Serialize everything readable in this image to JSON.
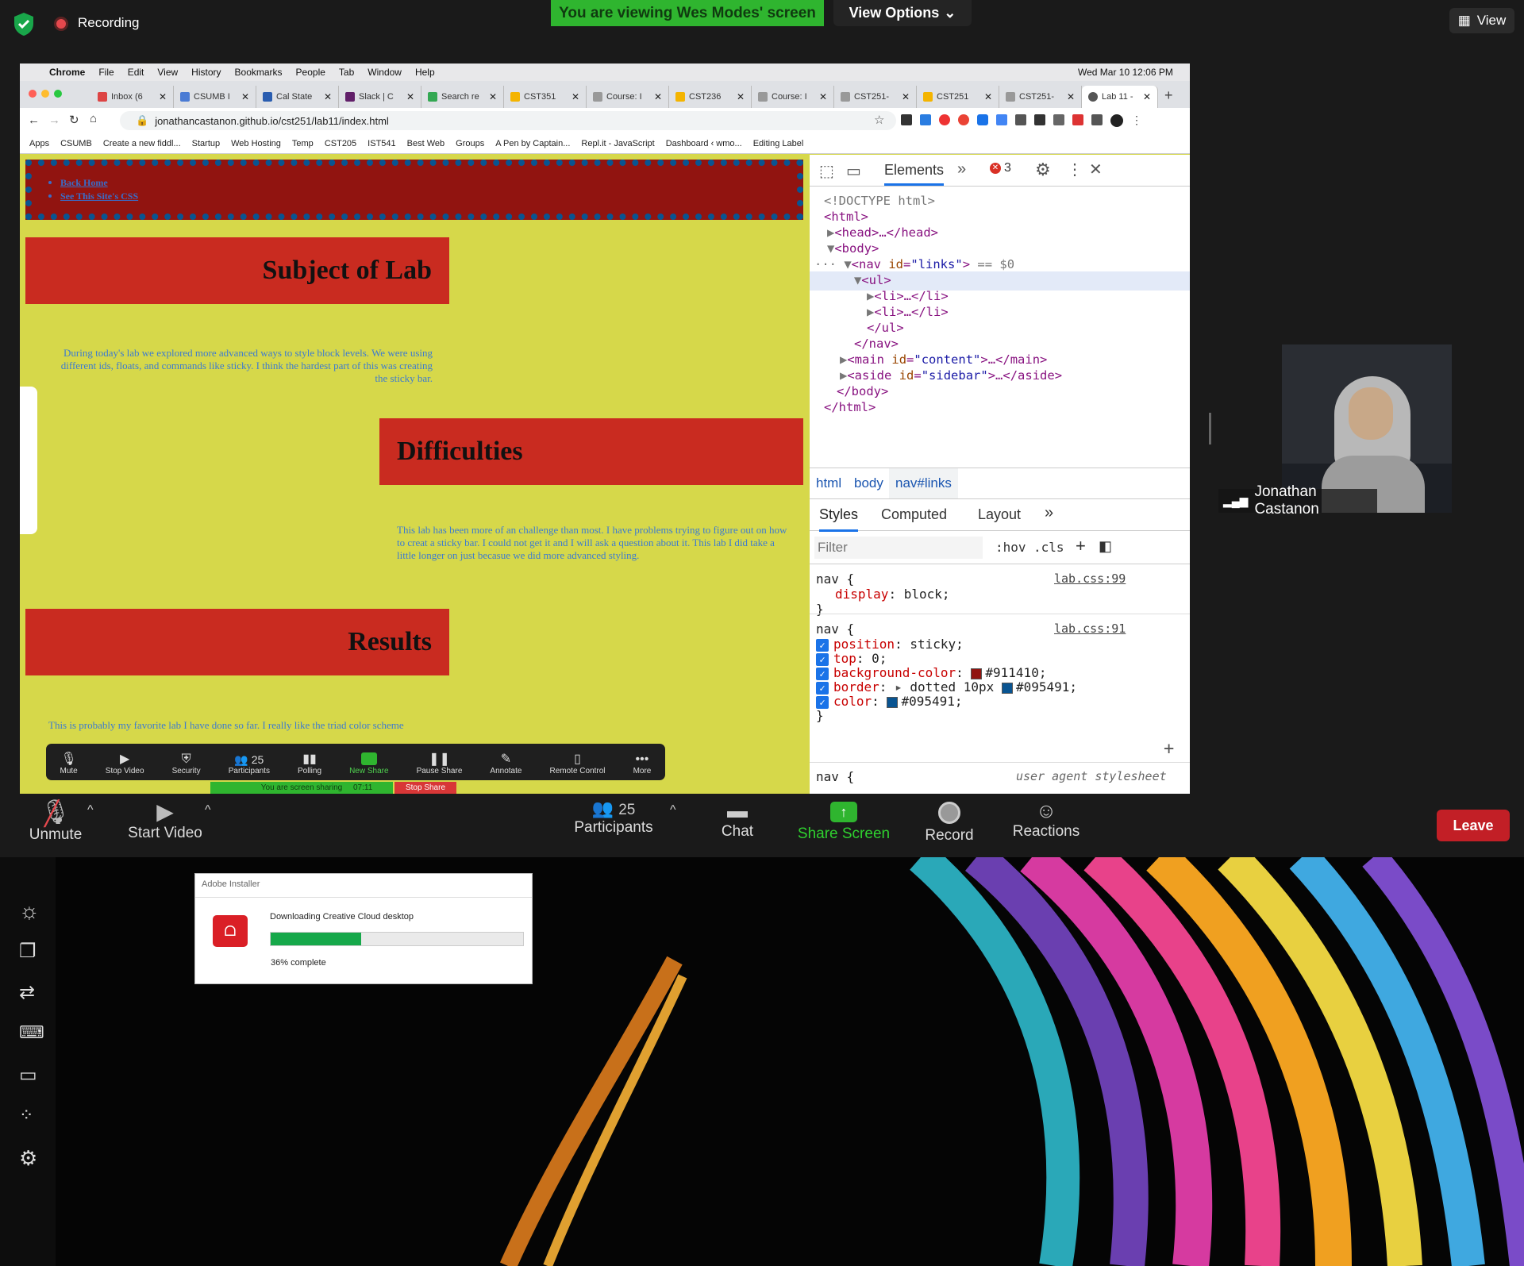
{
  "zoom": {
    "recording_label": "Recording",
    "viewing_banner": "You are viewing Wes Modes' screen",
    "view_options_label": "View Options",
    "view_label": "View",
    "participant_name": "Jonathan Castanon",
    "participants_count": "25",
    "bottom_controls": [
      {
        "label": "Unmute",
        "icon": "mic-muted-icon"
      },
      {
        "label": "Start Video",
        "icon": "video-off-icon"
      },
      {
        "label": "Participants",
        "icon": "participants-icon"
      },
      {
        "label": "Chat",
        "icon": "chat-icon"
      },
      {
        "label": "Share Screen",
        "icon": "share-screen-icon"
      },
      {
        "label": "Record",
        "icon": "record-icon"
      },
      {
        "label": "Reactions",
        "icon": "reactions-icon"
      }
    ],
    "leave_label": "Leave",
    "accent_green": "#2fb52f",
    "leave_red": "#c21f26"
  },
  "mac_menu": {
    "items": [
      "Chrome",
      "File",
      "Edit",
      "View",
      "History",
      "Bookmarks",
      "People",
      "Tab",
      "Window",
      "Help"
    ],
    "clock": "Wed Mar 10  12:06 PM"
  },
  "browser": {
    "tabs": [
      {
        "title": "Inbox (6"
      },
      {
        "title": "CSUMB I"
      },
      {
        "title": "Cal State"
      },
      {
        "title": "Slack | C"
      },
      {
        "title": "Search re"
      },
      {
        "title": "CST351"
      },
      {
        "title": "Course: I"
      },
      {
        "title": "CST236"
      },
      {
        "title": "Course: I"
      },
      {
        "title": "CST251-"
      },
      {
        "title": "CST251"
      },
      {
        "title": "CST251-"
      },
      {
        "title": "Lab 11 -"
      }
    ],
    "url": "jonathancastanon.github.io/cst251/lab11/index.html",
    "bookmarks": [
      "Apps",
      "CSUMB",
      "Create a new fiddl...",
      "Startup",
      "Web Hosting",
      "Temp",
      "CST205",
      "IST541",
      "Best Web",
      "Groups",
      "A Pen by Captain...",
      "Repl.it - JavaScript",
      "Dashboard ‹ wmo...",
      "Editing Label"
    ]
  },
  "page": {
    "nav_links": [
      "Back Home",
      "See This Site's CSS"
    ],
    "h1": "Subject of Lab",
    "p1": "During today's lab we explored more advanced ways to style block levels. We were using different ids, floats, and commands like sticky. I think the hardest part of this was creating the sticky bar.",
    "h2": "Difficulties",
    "p2": "This lab has been more of an challenge than most. I have problems trying to figure out on how to creat a sticky bar. I could not get it and I will ask a question about it. This lab I did take a little longer on just becasue we did more advanced styling.",
    "h3": "Results",
    "p3": "This is probably my favorite lab I have done so far. I really like the triad color scheme"
  },
  "zoom_mini": {
    "items": [
      "Mute",
      "Stop Video",
      "Security",
      "Participants",
      "Polling",
      "New Share",
      "Pause Share",
      "Annotate",
      "Remote Control",
      "More"
    ],
    "count": "25",
    "sharing_text": "You are screen sharing",
    "timer": "07:11",
    "stop_share": "Stop Share"
  },
  "devtools": {
    "tab_elements": "Elements",
    "error_count": "3",
    "dom": {
      "doctype": "<!DOCTYPE html>",
      "html_open": "<html>",
      "head": "<head>…</head>",
      "body_open": "<body>",
      "nav_open_tag": "<nav",
      "nav_attr": "id",
      "nav_val": "\"links\"",
      "nav_suffix": "== $0",
      "ul_open": "<ul>",
      "li1": "<li>…</li>",
      "li2": "<li>…</li>",
      "ul_close": "</ul>",
      "nav_close": "</nav>",
      "main_tag": "<main",
      "main_attr": "id",
      "main_val": "\"content\"",
      "main_rest": ">…</main>",
      "aside_tag": "<aside",
      "aside_attr": "id",
      "aside_val": "\"sidebar\"",
      "aside_rest": ">…</aside>",
      "body_close": "</body>",
      "html_close": "</html>"
    },
    "breadcrumbs": [
      "html",
      "body",
      "nav#links"
    ],
    "style_tabs": [
      "Styles",
      "Computed",
      "Layout"
    ],
    "filter_placeholder": "Filter",
    "hov": ":hov",
    "cls": ".cls",
    "rules": [
      {
        "selector": "nav {",
        "source": "lab.css:99",
        "decls": [
          {
            "prop": "display",
            "value": "block;"
          }
        ]
      },
      {
        "selector": "nav {",
        "source": "lab.css:91",
        "decls": [
          {
            "prop": "position",
            "value": "sticky;"
          },
          {
            "prop": "top",
            "value": "0;"
          },
          {
            "prop": "background-color",
            "value": "#911410;",
            "swatch": "#911410"
          },
          {
            "prop": "border",
            "value": "dotted 10px",
            "value2": "#095491;",
            "swatch": "#095491"
          },
          {
            "prop": "color",
            "value": "#095491;",
            "swatch": "#095491"
          }
        ]
      },
      {
        "selector": "nav {",
        "source": "user agent stylesheet",
        "decls": []
      }
    ]
  },
  "adobe": {
    "title": "Adobe Installer",
    "message": "Downloading Creative Cloud desktop",
    "progress_percent": 36,
    "progress_text": "36% complete"
  }
}
